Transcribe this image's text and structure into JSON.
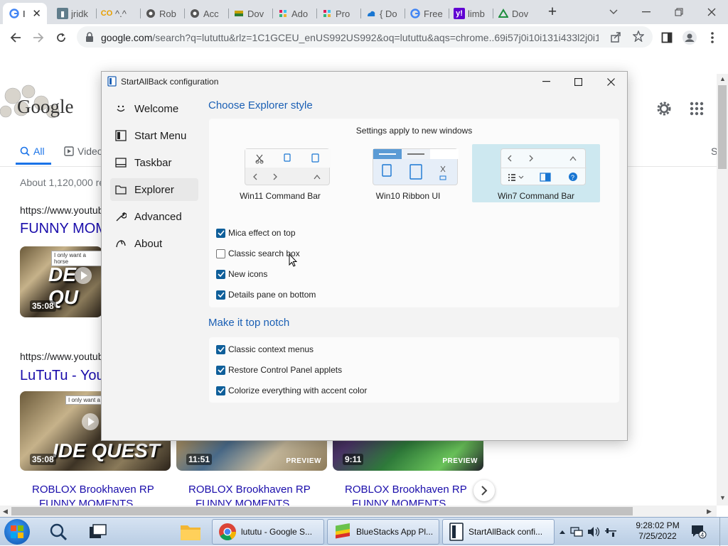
{
  "browser": {
    "tabs": [
      {
        "label": "I",
        "favicon": "google-icon",
        "active": true
      },
      {
        "label": "jridk",
        "favicon": "bookmark-icon"
      },
      {
        "label": "^.^",
        "favicon": "cc-icon"
      },
      {
        "label": "Rob",
        "favicon": "chrome-icon"
      },
      {
        "label": "Acc",
        "favicon": "chrome-icon"
      },
      {
        "label": "Dov",
        "favicon": "layers-icon"
      },
      {
        "label": "Ado",
        "favicon": "slack-icon"
      },
      {
        "label": "Pro",
        "favicon": "slack-icon"
      },
      {
        "label": "{ Do",
        "favicon": "cloud-icon"
      },
      {
        "label": "Free",
        "favicon": "google-icon"
      },
      {
        "label": "limb",
        "favicon": "yahoo-icon"
      },
      {
        "label": "Dov",
        "favicon": "drive-icon"
      }
    ],
    "url_host": "google.com",
    "url_rest": "/search?q=lututtu&rlz=1C1GCEU_enUS992US992&oq=lututtu&aqs=chrome..69i57j0i10i131i433l2j0i10..."
  },
  "google": {
    "logo_text": "Google",
    "tabs": {
      "all": "All",
      "videos": "Videos"
    },
    "truncated_right": "S",
    "results_count": "About 1,120,000 re",
    "result1_url": "https://www.youtub",
    "result1_title": "FUNNY MOM",
    "result1_duration": "35:08",
    "result1_thumb_text": "DE QU",
    "result1_sign": "I only want a horse",
    "result2_url": "https://www.youtub",
    "result2_title": "LuTuTu - You",
    "videos": [
      {
        "duration": "35:08",
        "thumb_text": "IDE QUEST",
        "sign": "I only want a",
        "title": "ROBLOX Brookhaven RP",
        "sub": "FUNNY MOMENTS"
      },
      {
        "duration": "11:51",
        "preview": "PREVIEW",
        "title": "ROBLOX Brookhaven RP",
        "sub": "FUNNY MOMENTS"
      },
      {
        "duration": "9:11",
        "preview": "PREVIEW",
        "title": "ROBLOX Brookhaven RP",
        "sub": "FUNNY MOMENTS"
      }
    ]
  },
  "dialog": {
    "title": "StartAllBack configuration",
    "nav": [
      {
        "label": "Welcome",
        "icon": "smile-icon"
      },
      {
        "label": "Start Menu",
        "icon": "start-menu-icon"
      },
      {
        "label": "Taskbar",
        "icon": "taskbar-icon"
      },
      {
        "label": "Explorer",
        "icon": "folder-icon",
        "selected": true
      },
      {
        "label": "Advanced",
        "icon": "wrench-icon"
      },
      {
        "label": "About",
        "icon": "about-icon"
      }
    ],
    "section1_title": "Choose Explorer style",
    "apply_note": "Settings apply to new windows",
    "styles": [
      {
        "label": "Win11 Command Bar"
      },
      {
        "label": "Win10 Ribbon UI"
      },
      {
        "label": "Win7 Command Bar",
        "selected": true
      }
    ],
    "explorer_options": [
      {
        "label": "Mica effect on top",
        "checked": true
      },
      {
        "label": "Classic search box",
        "checked": false
      },
      {
        "label": "New icons",
        "checked": true
      },
      {
        "label": "Details pane on bottom",
        "checked": true
      }
    ],
    "section2_title": "Make it top notch",
    "topnotch_options": [
      {
        "label": "Classic context menus",
        "checked": true
      },
      {
        "label": "Restore Control Panel applets",
        "checked": true
      },
      {
        "label": "Colorize everything with accent color",
        "checked": true
      }
    ]
  },
  "taskbar": {
    "buttons": [
      {
        "label": "lututu - Google S...",
        "icon": "chrome-icon"
      },
      {
        "label": "BlueStacks App Pl...",
        "icon": "bluestacks-icon"
      },
      {
        "label": "StartAllBack confi...",
        "icon": "startallback-icon"
      }
    ],
    "time": "9:28:02 PM",
    "date": "7/25/2022",
    "notifications": "4"
  }
}
